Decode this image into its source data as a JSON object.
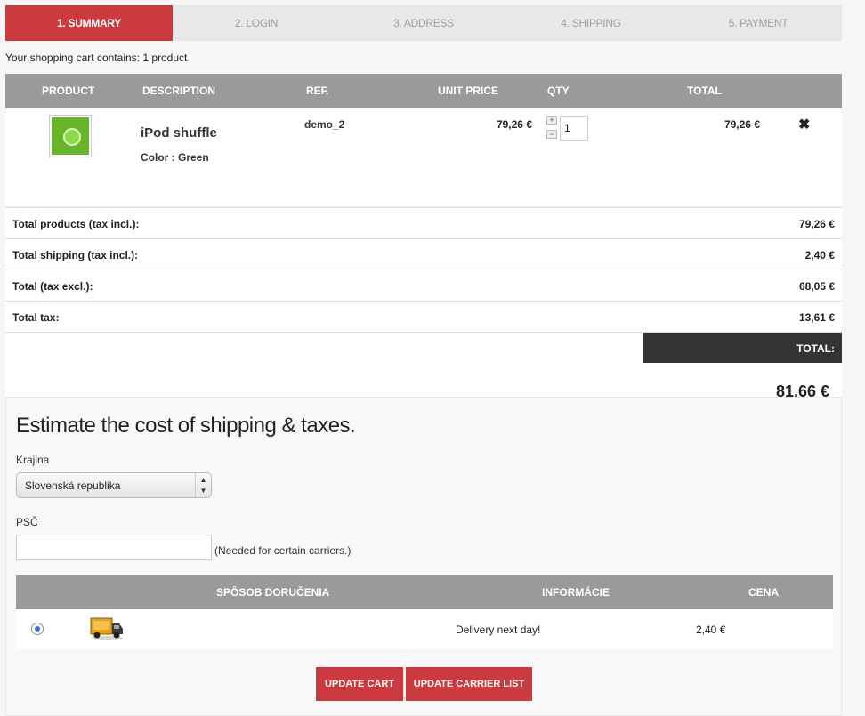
{
  "steps": [
    "1. Summary",
    "2. Login",
    "3. Address",
    "4. Shipping",
    "5. Payment"
  ],
  "cart_count": "Your shopping cart contains: 1 product",
  "cart_headers": {
    "product": "PRODUCT",
    "description": "DESCRIPTION",
    "ref": "REF.",
    "unit_price": "UNIT PRICE",
    "qty": "QTY",
    "total": "TOTAL"
  },
  "product": {
    "name": "iPod shuffle",
    "attributes": "Color : Green",
    "ref": "demo_2",
    "unit_price": "79,26 €",
    "qty": "1",
    "total": "79,26 €",
    "qty_plus": "+",
    "qty_minus": "−",
    "delete": "✖"
  },
  "summary": [
    {
      "label": "Total products (tax incl.):",
      "value": "79,26 €"
    },
    {
      "label": "Total shipping (tax incl.):",
      "value": "2,40 €"
    },
    {
      "label": "Total (tax excl.):",
      "value": "68,05 €"
    },
    {
      "label": "Total tax:",
      "value": "13,61 €"
    }
  ],
  "grand_total": {
    "label": "TOTAL:",
    "value": "81,66 €"
  },
  "estimate": {
    "title": "Estimate the cost of shipping & taxes.",
    "country_label": "Krajina",
    "country_value": "Slovenská republika",
    "zip_label": "PSČ",
    "zip_value": "",
    "zip_note": "(Needed for certain carriers.)"
  },
  "carrier_headers": {
    "method": "SPÔSOB DORUČENIA",
    "info": "INFORMÁCIE",
    "price": "CENA"
  },
  "carrier": {
    "info": "Delivery next day!",
    "price": "2,40 €",
    "icon": "truck-icon"
  },
  "buttons": {
    "update_cart": "UPDATE CART",
    "update_carrier": "UPDATE CARRIER LIST"
  },
  "colors": {
    "accent": "#cb3a3f",
    "header_gray": "#9a9a9a",
    "dark": "#333333"
  }
}
